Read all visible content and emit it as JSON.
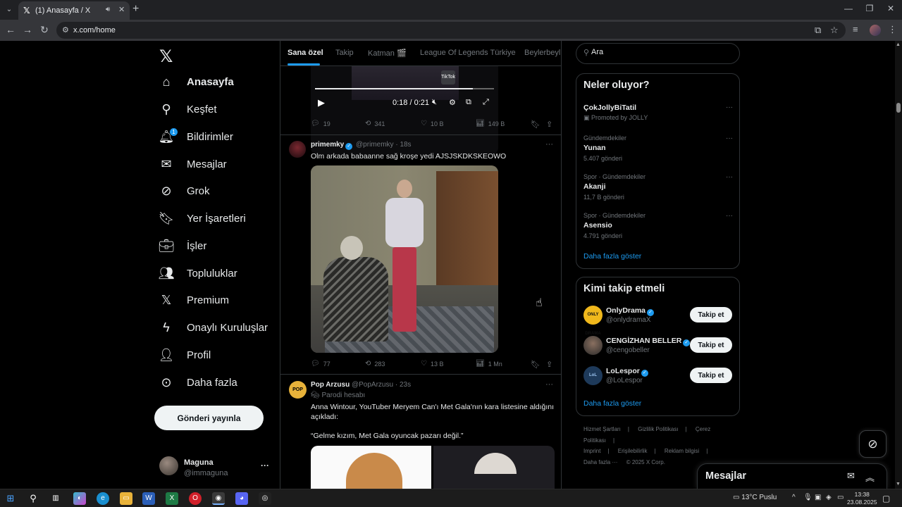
{
  "browser": {
    "tab_title": "(1) Anasayfa / X",
    "url": "x.com/home"
  },
  "nav": {
    "items": [
      {
        "label": "Anasayfa",
        "icon": "home-icon"
      },
      {
        "label": "Keşfet",
        "icon": "search-icon"
      },
      {
        "label": "Bildirimler",
        "icon": "bell-icon",
        "badge": "1"
      },
      {
        "label": "Mesajlar",
        "icon": "mail-icon"
      },
      {
        "label": "Grok",
        "icon": "grok-icon"
      },
      {
        "label": "Yer İşaretleri",
        "icon": "bookmark-icon"
      },
      {
        "label": "İşler",
        "icon": "briefcase-icon"
      },
      {
        "label": "Topluluklar",
        "icon": "people-icon"
      },
      {
        "label": "Premium",
        "icon": "x-icon"
      },
      {
        "label": "Onaylı Kuruluşlar",
        "icon": "lightning-icon"
      },
      {
        "label": "Profil",
        "icon": "person-icon"
      },
      {
        "label": "Daha fazla",
        "icon": "more-circle-icon"
      }
    ],
    "post_button": "Gönderi yayınla",
    "user": {
      "name": "Maguna",
      "handle": "@immaguna"
    }
  },
  "timeline": {
    "tabs": [
      "Sana özel",
      "Takip",
      "Katman 🎬",
      "League Of Legends Türkiye",
      "Beylerbeyli"
    ],
    "tweets": [
      {
        "video_time": "0:18 / 0:21",
        "progress": 0.88,
        "tiktok_label": "TikTok",
        "replies": "19",
        "reposts": "341",
        "likes": "10 B",
        "views": "149 B"
      },
      {
        "name": "primemky",
        "handle": "@primemky",
        "time": "18s",
        "text": "Olm arkada babaanne sağ kroşe yedi AJSJSKDKSKEOWO",
        "replies": "77",
        "reposts": "283",
        "likes": "13 B",
        "views": "1 Mn"
      },
      {
        "name": "Pop Arzusu",
        "handle": "@PopArzusu",
        "time": "23s",
        "avatar_text": "POP ARZUSU",
        "label": "Parodi hesabı",
        "text1": "Anna Wintour, YouTuber Meryem Can'ı Met Gala'nın kara listesine aldığını açıkladı:",
        "text2": "“Gelme kızım, Met Gala oyuncak pazarı değil.”"
      }
    ]
  },
  "sidebar": {
    "search_placeholder": "Ara",
    "trends_title": "Neler oluyor?",
    "trends": [
      {
        "name": "ÇokJollyBiTatil",
        "meta": "Promoted by JOLLY",
        "count": ""
      },
      {
        "meta": "Gündemdekiler",
        "name": "Yunan",
        "count": "5.407 gönderi"
      },
      {
        "meta": "Spor · Gündemdekiler",
        "name": "Akanji",
        "count": "11,7 B gönderi"
      },
      {
        "meta": "Spor · Gündemdekiler",
        "name": "Asensio",
        "count": "4.791 gönderi"
      }
    ],
    "show_more": "Daha fazla göster",
    "who_title": "Kimi takip etmeli",
    "who": [
      {
        "name": "OnlyDrama",
        "handle": "@onlydramaX",
        "avatar_text": "ONLY DRAMA",
        "color": "#f0b81c"
      },
      {
        "name": "CENGİZHAN BELLER",
        "handle": "@cengobeller",
        "avatar_text": "",
        "color": "#3a3a3a"
      },
      {
        "name": "LoLespor",
        "handle": "@LoLespor",
        "avatar_text": "LoL",
        "color": "#1e3a5a"
      }
    ],
    "follow_label": "Takip et",
    "footer": [
      "Hizmet Şartları",
      "Gizlilik Politikası",
      "Çerez Politikası",
      "Imprint",
      "Erişilebilirlik",
      "Reklam bilgisi",
      "Daha fazla ···",
      "© 2025 X Corp."
    ]
  },
  "messages_drawer": {
    "title": "Mesajlar"
  },
  "taskbar": {
    "weather": "13°C  Puslu",
    "time": "13:38",
    "date": "23.08.2025"
  }
}
